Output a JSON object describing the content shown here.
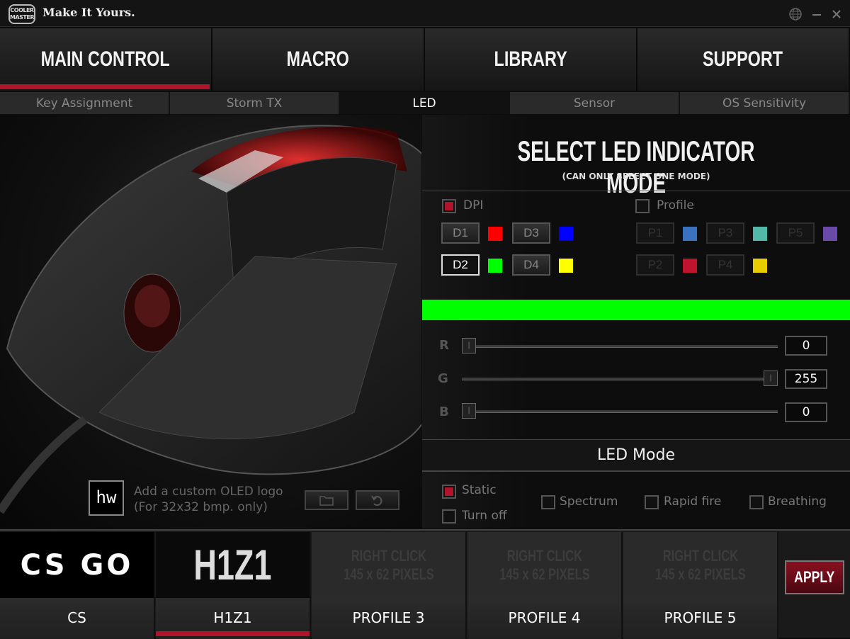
{
  "titlebar": {
    "logo_text": "COOLER MASTER",
    "title": "Make It Yours.",
    "icons": [
      "globe-icon",
      "minimize-icon",
      "close-icon"
    ]
  },
  "main_tabs": [
    {
      "label": "MAIN CONTROL",
      "active": true
    },
    {
      "label": "MACRO",
      "active": false
    },
    {
      "label": "LIBRARY",
      "active": false
    },
    {
      "label": "SUPPORT",
      "active": false
    }
  ],
  "sub_tabs": [
    {
      "label": "Key Assignment",
      "active": false
    },
    {
      "label": "Storm TX",
      "active": false
    },
    {
      "label": "LED",
      "active": true
    },
    {
      "label": "Sensor",
      "active": false
    },
    {
      "label": "OS Sensitivity",
      "active": false
    }
  ],
  "oled": {
    "logo_text": "hw",
    "line1": "Add a custom OLED logo",
    "line2": "(For 32x32 bmp. only)",
    "icons": [
      "folder-icon",
      "reset-icon"
    ]
  },
  "led_indicator": {
    "title": "SELECT LED INDICATOR MODE",
    "subtitle": "(CAN ONLY SELECT ONE MODE)",
    "dpi": {
      "label": "DPI",
      "checked": true,
      "items": [
        {
          "label": "D1",
          "color": "#ff0000",
          "selected": false
        },
        {
          "label": "D2",
          "color": "#00ff00",
          "selected": true
        },
        {
          "label": "D3",
          "color": "#0000ff",
          "selected": false
        },
        {
          "label": "D4",
          "color": "#ffff00",
          "selected": false
        }
      ]
    },
    "profile": {
      "label": "Profile",
      "checked": false,
      "items": [
        {
          "label": "P1",
          "color": "#3a72c0"
        },
        {
          "label": "P2",
          "color": "#c0142e"
        },
        {
          "label": "P3",
          "color": "#52b8a8"
        },
        {
          "label": "P4",
          "color": "#e8cc00"
        },
        {
          "label": "P5",
          "color": "#6a4aa8"
        }
      ]
    },
    "current_color": "#00ff00"
  },
  "rgb": [
    {
      "label": "R",
      "value": "0",
      "level": 0
    },
    {
      "label": "G",
      "value": "255",
      "level": 255
    },
    {
      "label": "B",
      "value": "0",
      "level": 0
    }
  ],
  "led_mode": {
    "title": "LED Mode",
    "options": [
      {
        "label": "Static",
        "checked": true
      },
      {
        "label": "Turn off",
        "checked": false
      },
      {
        "label": "Spectrum",
        "checked": false
      },
      {
        "label": "Rapid fire",
        "checked": false
      },
      {
        "label": "Breathing",
        "checked": false
      }
    ]
  },
  "profiles": [
    {
      "name": "CS",
      "image": "CS GO",
      "active": false
    },
    {
      "name": "H1Z1",
      "image": "H1Z1",
      "active": true
    },
    {
      "name": "PROFILE 3",
      "placeholder1": "RIGHT CLICK",
      "placeholder2": "145 x 62 PIXELS"
    },
    {
      "name": "PROFILE 4",
      "placeholder1": "RIGHT CLICK",
      "placeholder2": "145 x 62 PIXELS"
    },
    {
      "name": "PROFILE 5",
      "placeholder1": "RIGHT CLICK",
      "placeholder2": "145 x 62 PIXELS"
    }
  ],
  "apply_label": "APPLY",
  "accent_color": "#b0142a"
}
